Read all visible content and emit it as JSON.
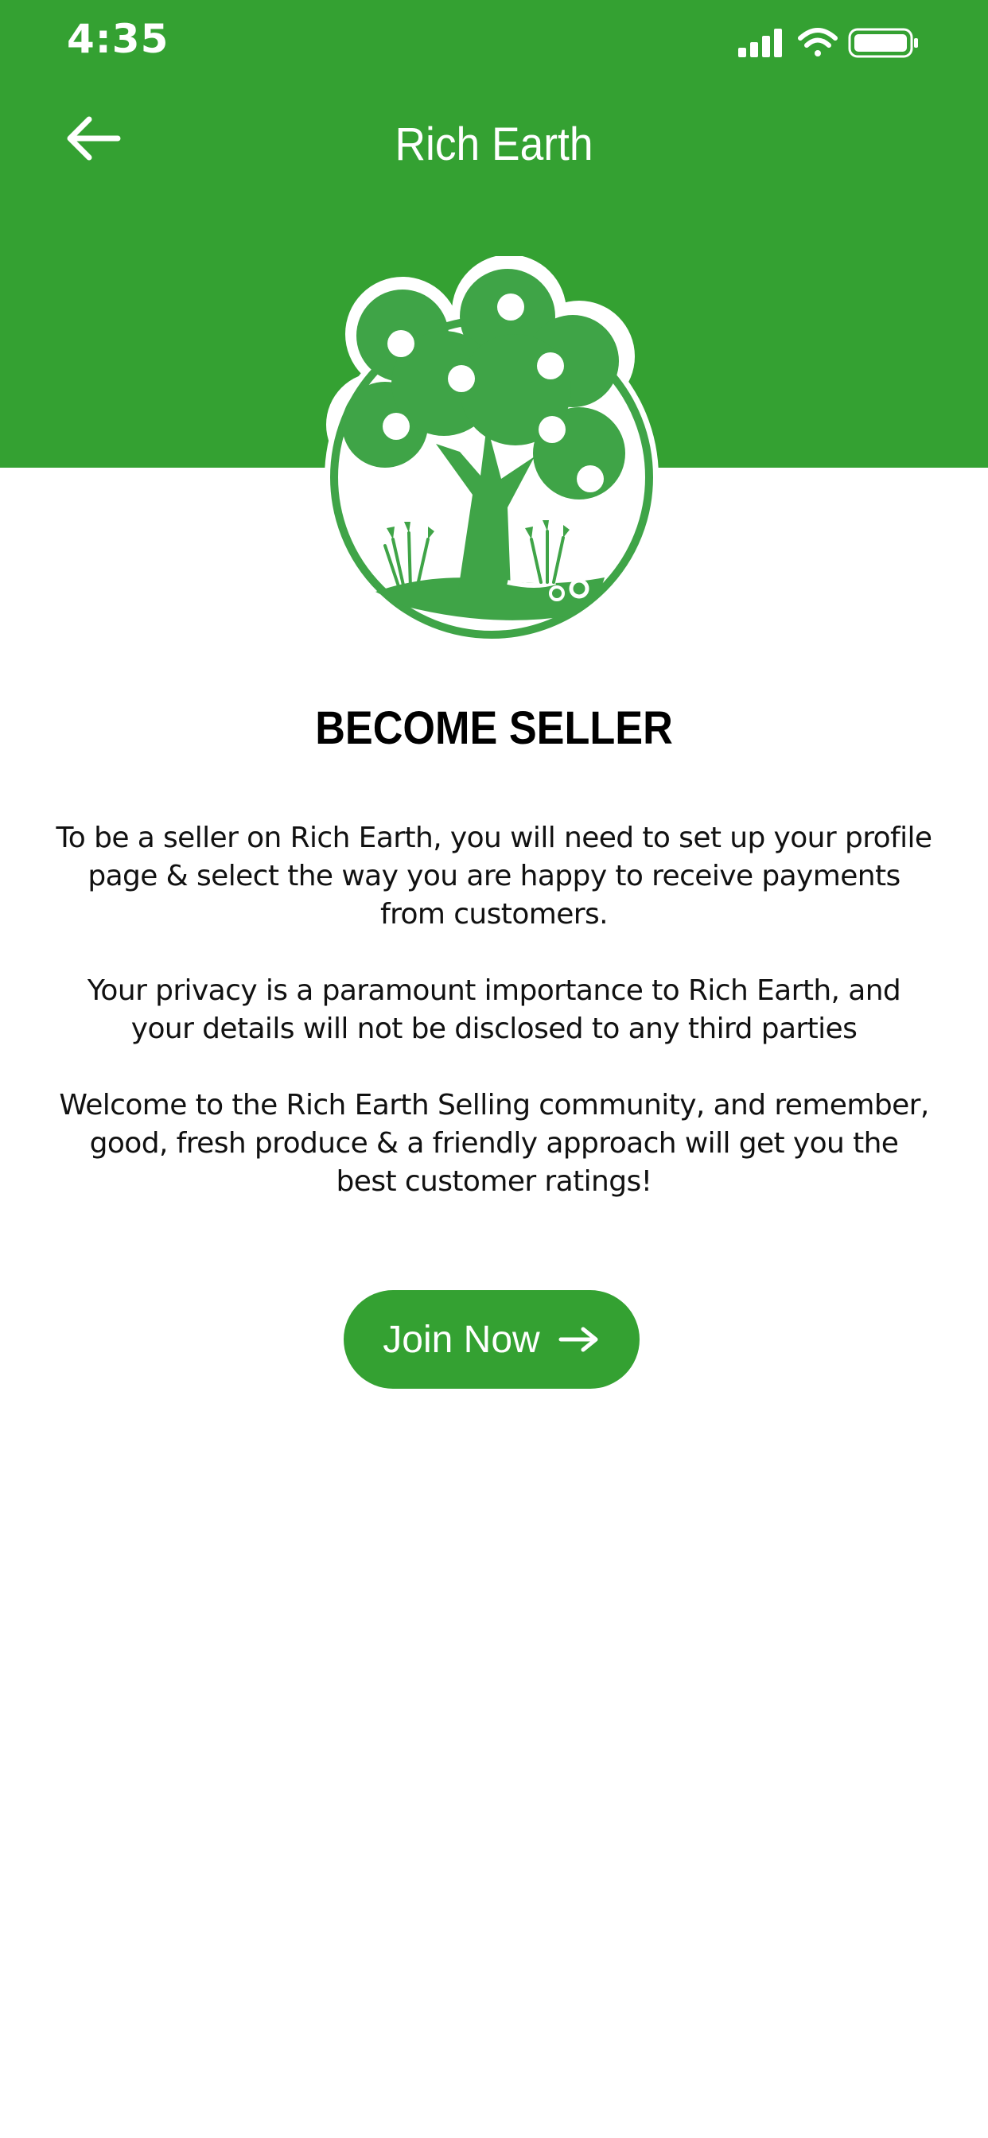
{
  "status_bar": {
    "time": "4:35"
  },
  "header": {
    "title": "Rich Earth"
  },
  "content": {
    "heading": "BECOME SELLER",
    "paragraphs": [
      "To be a seller on Rich Earth, you will need to set up your profile page & select the way you are happy to receive payments from customers.",
      "Your privacy is a paramount importance to Rich Earth, and your details will not be disclosed to any third parties",
      "Welcome to the Rich Earth Selling community, and remember, good, fresh produce & a friendly approach will get you the best customer ratings!"
    ]
  },
  "join_button": {
    "label": "Join Now"
  },
  "colors": {
    "brand_green": "#34a132",
    "logo_green": "#3fa447",
    "text": "#111111",
    "background": "#ffffff"
  },
  "icons": {
    "back": "arrow-left-icon",
    "join": "arrow-right-icon",
    "logo": "tree-logo-icon",
    "signal": "cellular-signal-icon",
    "wifi": "wifi-icon",
    "battery": "battery-icon"
  }
}
